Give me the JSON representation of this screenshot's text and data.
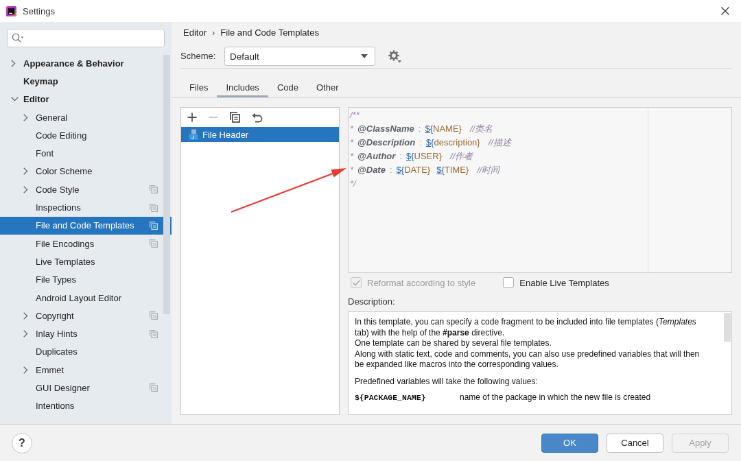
{
  "window": {
    "title": "Settings"
  },
  "sidebar": {
    "items": [
      {
        "label": "Appearance & Behavior",
        "kind": "group",
        "expanded": false,
        "selected": false,
        "scope_icon": false
      },
      {
        "label": "Keymap",
        "kind": "page",
        "selected": false,
        "scope_icon": false
      },
      {
        "label": "Editor",
        "kind": "group",
        "expanded": true,
        "selected": false,
        "scope_icon": false,
        "children": [
          {
            "label": "General",
            "kind": "group",
            "expanded": false,
            "selected": false,
            "scope_icon": false
          },
          {
            "label": "Code Editing",
            "kind": "page",
            "selected": false,
            "scope_icon": false
          },
          {
            "label": "Font",
            "kind": "page",
            "selected": false,
            "scope_icon": false
          },
          {
            "label": "Color Scheme",
            "kind": "group",
            "expanded": false,
            "selected": false,
            "scope_icon": false
          },
          {
            "label": "Code Style",
            "kind": "group",
            "expanded": false,
            "selected": false,
            "scope_icon": true
          },
          {
            "label": "Inspections",
            "kind": "page",
            "selected": false,
            "scope_icon": true
          },
          {
            "label": "File and Code Templates",
            "kind": "page",
            "selected": true,
            "scope_icon": true
          },
          {
            "label": "File Encodings",
            "kind": "page",
            "selected": false,
            "scope_icon": true
          },
          {
            "label": "Live Templates",
            "kind": "page",
            "selected": false,
            "scope_icon": false
          },
          {
            "label": "File Types",
            "kind": "page",
            "selected": false,
            "scope_icon": false
          },
          {
            "label": "Android Layout Editor",
            "kind": "page",
            "selected": false,
            "scope_icon": false
          },
          {
            "label": "Copyright",
            "kind": "group",
            "expanded": false,
            "selected": false,
            "scope_icon": true
          },
          {
            "label": "Inlay Hints",
            "kind": "group",
            "expanded": false,
            "selected": false,
            "scope_icon": true
          },
          {
            "label": "Duplicates",
            "kind": "page",
            "selected": false,
            "scope_icon": false
          },
          {
            "label": "Emmet",
            "kind": "group",
            "expanded": false,
            "selected": false,
            "scope_icon": false
          },
          {
            "label": "GUI Designer",
            "kind": "page",
            "selected": false,
            "scope_icon": true
          },
          {
            "label": "Intentions",
            "kind": "page",
            "selected": false,
            "scope_icon": false
          }
        ]
      }
    ]
  },
  "breadcrumb": {
    "items": [
      "Editor",
      "File and Code Templates"
    ],
    "separator": "›"
  },
  "scheme": {
    "label": "Scheme:",
    "value": "Default"
  },
  "tabs": [
    {
      "label": "Files",
      "selected": false
    },
    {
      "label": "Includes",
      "selected": true
    },
    {
      "label": "Code",
      "selected": false
    },
    {
      "label": "Other",
      "selected": false
    }
  ],
  "template_toolbar": [
    {
      "kind": "add",
      "disabled": false
    },
    {
      "kind": "remove",
      "disabled": true
    },
    {
      "kind": "copy",
      "disabled": false
    },
    {
      "kind": "reset",
      "disabled": false
    }
  ],
  "templates": [
    {
      "name": "File Header",
      "selected": true
    }
  ],
  "editor": {
    "lines": [
      [
        {
          "kind": "marker",
          "text": "/**"
        }
      ],
      [
        {
          "kind": "marker",
          "text": "*"
        },
        {
          "kind": "tag",
          "text": "@ClassName"
        },
        {
          "kind": "punct",
          "text": ":"
        },
        {
          "kind": "var-open",
          "text": "${"
        },
        {
          "kind": "var-body",
          "text": "NAME}"
        },
        {
          "kind": "comment",
          "text": "//类名"
        }
      ],
      [
        {
          "kind": "marker",
          "text": "*"
        },
        {
          "kind": "tag",
          "text": "@Description"
        },
        {
          "kind": "punct",
          "text": ":"
        },
        {
          "kind": "var-open",
          "text": "${"
        },
        {
          "kind": "var-body",
          "text": "description}"
        },
        {
          "kind": "comment",
          "text": "//描述"
        }
      ],
      [
        {
          "kind": "marker",
          "text": "*"
        },
        {
          "kind": "tag",
          "text": "@Author"
        },
        {
          "kind": "punct",
          "text": ":"
        },
        {
          "kind": "var-open",
          "text": "${"
        },
        {
          "kind": "var-body",
          "text": "USER}"
        },
        {
          "kind": "comment",
          "text": "//作者"
        }
      ],
      [
        {
          "kind": "marker",
          "text": "*"
        },
        {
          "kind": "tag",
          "text": "@Date"
        },
        {
          "kind": "punct",
          "text": ":"
        },
        {
          "kind": "var-open",
          "text": "${"
        },
        {
          "kind": "var-body",
          "text": "DATE}"
        },
        {
          "kind": "var-open",
          "text": "${"
        },
        {
          "kind": "var-body",
          "text": "TIME}"
        },
        {
          "kind": "comment",
          "text": "//时间"
        }
      ],
      [
        {
          "kind": "marker",
          "text": "*/"
        }
      ]
    ]
  },
  "checkboxes": [
    {
      "label": "Reformat according to style",
      "checked": true,
      "disabled": true
    },
    {
      "label": "Enable Live Templates",
      "checked": false,
      "disabled": false
    }
  ],
  "description": {
    "label": "Description:",
    "paragraphs": [
      "In this template, you can specify a code fragment to be included into file templates (*Templates* tab) with the help of the **#parse** directive.",
      "One template can be shared by several file templates.",
      "Along with static text, code and comments, you can also use predefined variables that will then be expanded like macros into the corresponding values."
    ],
    "variables_intro": "Predefined variables will take the following values:",
    "variables": [
      {
        "name": "${PACKAGE_NAME}",
        "meaning": "name of the package in which the new file is created"
      }
    ]
  },
  "help_button": "?",
  "buttons": [
    {
      "label": "OK",
      "kind": "primary",
      "disabled": false
    },
    {
      "label": "Cancel",
      "kind": "normal",
      "disabled": false
    },
    {
      "label": "Apply",
      "kind": "normal",
      "disabled": true
    }
  ],
  "annotations": [
    {
      "kind": "arrow"
    }
  ]
}
